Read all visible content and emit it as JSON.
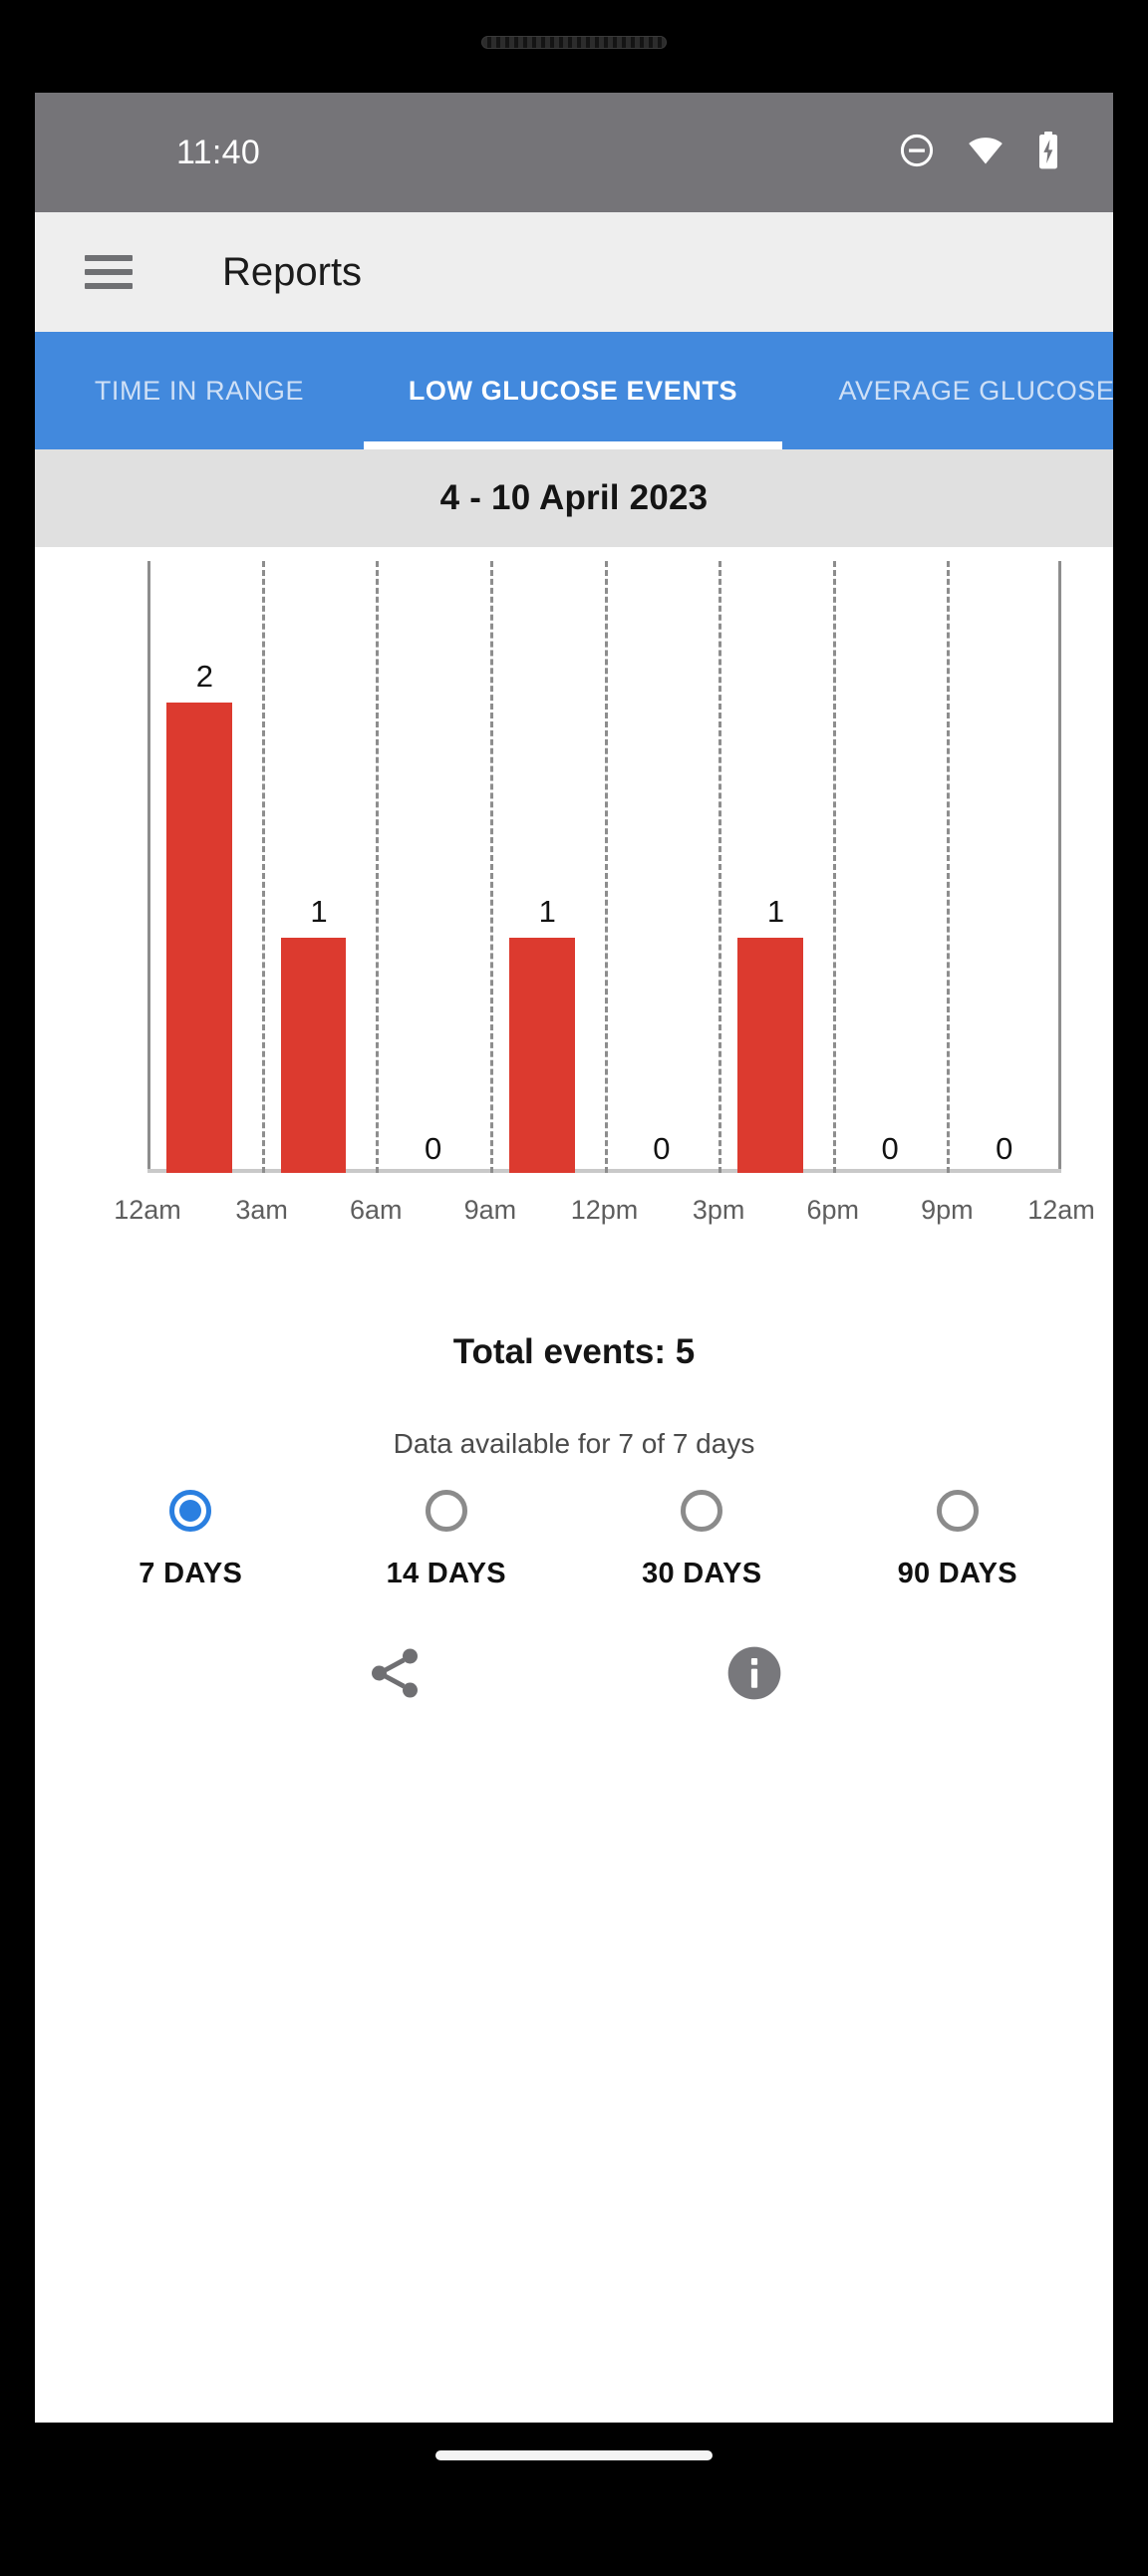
{
  "device": {
    "speaker_grille": "speaker-grille",
    "home_indicator": "home-indicator"
  },
  "status_bar": {
    "time": "11:40",
    "icons": [
      "do-not-disturb-icon",
      "wifi-icon",
      "battery-charging-icon"
    ],
    "background": "#757478",
    "text_color": "#ffffff"
  },
  "app_bar": {
    "menu_icon": "hamburger-menu-icon",
    "title": "Reports",
    "background": "#eeeeee"
  },
  "tabs": {
    "accent": "#4289dd",
    "active_index": 1,
    "items": [
      {
        "label": "TIME IN RANGE"
      },
      {
        "label": "LOW GLUCOSE EVENTS"
      },
      {
        "label": "AVERAGE GLUCOSE"
      }
    ]
  },
  "date_header": {
    "label": "4 - 10 April 2023",
    "background": "#e0e0e0"
  },
  "chart_data": {
    "type": "bar",
    "title": "Low Glucose Events",
    "categories": [
      "12am-3am",
      "3am-6am",
      "6am-9am",
      "9am-12pm",
      "12pm-3pm",
      "3pm-6pm",
      "6pm-9pm",
      "9pm-12am"
    ],
    "values": [
      2,
      1,
      0,
      1,
      0,
      1,
      0,
      0
    ],
    "data_labels": [
      "2",
      "1",
      "0",
      "1",
      "0",
      "1",
      "0",
      "0"
    ],
    "tick_labels": [
      "12am",
      "3am",
      "6am",
      "9am",
      "12pm",
      "3pm",
      "6pm",
      "9pm",
      "12am"
    ],
    "xlabel": "",
    "ylabel": "",
    "ylim": [
      0,
      2.6
    ],
    "grid": true,
    "grid_style": "dashed-vertical",
    "bar_color": "#dc3a2f",
    "legend": "none"
  },
  "summary": {
    "total_events": "Total events: 5",
    "availability": "Data available for 7 of 7 days"
  },
  "range_selector": {
    "selected_index": 0,
    "accent": "#2a7fe0",
    "options": [
      {
        "label": "7 DAYS"
      },
      {
        "label": "14 DAYS"
      },
      {
        "label": "30 DAYS"
      },
      {
        "label": "90 DAYS"
      }
    ]
  },
  "bottom_actions": {
    "items": [
      {
        "icon": "share-icon"
      },
      {
        "icon": "info-icon"
      }
    ],
    "icon_color": "#6f6f72"
  }
}
